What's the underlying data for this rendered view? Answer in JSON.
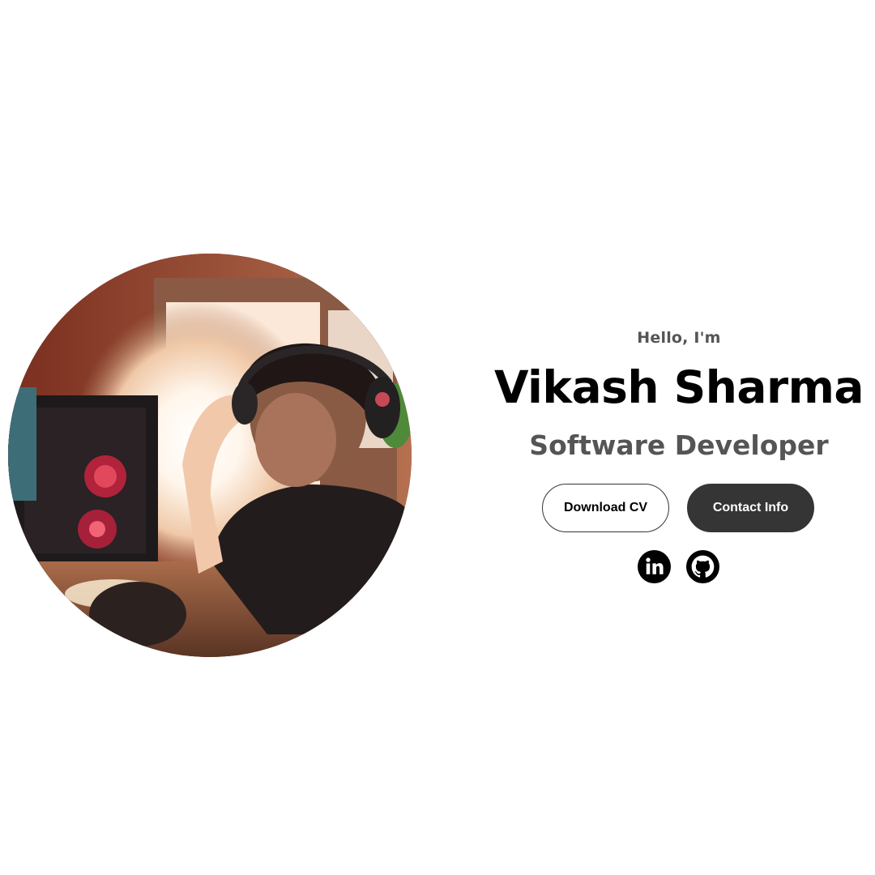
{
  "profile": {
    "photo_alt": "profile-photo"
  },
  "hero": {
    "greeting": "Hello, I'm",
    "name": "Vikash Sharma",
    "title": "Software Developer"
  },
  "buttons": {
    "download_cv": "Download CV",
    "contact_info": "Contact Info"
  },
  "social": [
    {
      "icon": "linkedin-icon"
    },
    {
      "icon": "github-icon"
    }
  ],
  "colors": {
    "background": "#ffffff",
    "name": "#000000",
    "subtle_text": "#555555",
    "button_dark": "#353535"
  }
}
